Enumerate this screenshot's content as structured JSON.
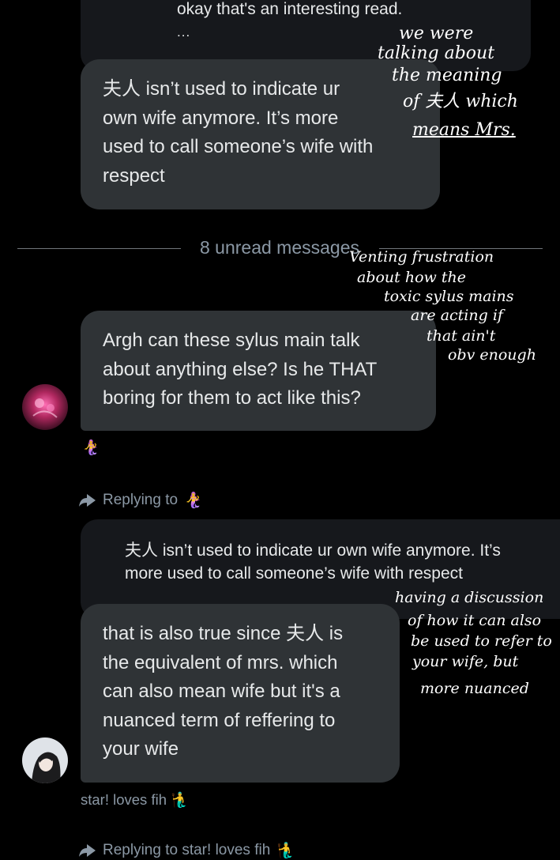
{
  "top_quote": {
    "text": "okay that's an interesting read.",
    "ellipsis": "..."
  },
  "messages": [
    {
      "text_lines": [
        "夫人 isn’t used to indicate ur",
        "own wife anymore. It’s more",
        "used to call someone’s wife with",
        "respect"
      ]
    },
    {
      "text_lines": [
        "Argh can these sylus main talk",
        "about anything else? Is he THAT",
        "boring for them to act like this?"
      ],
      "reaction": "🧜‍♀️"
    },
    {
      "replying_to_label": "Replying to",
      "replying_to_emoji": "🧜‍♀️",
      "quoted_lines": [
        "夫人 isn’t used to indicate ur own wife anymore. It’s",
        "more used to call someone’s wife with respect"
      ],
      "text_lines": [
        "that is also true since 夫人 is",
        "the equivalent of mrs. which",
        "can also mean wife but it's a",
        "nuanced term of reffering to",
        "your wife"
      ],
      "sender": "star! loves fih 🧜‍♂️"
    }
  ],
  "unread_divider": "8 unread messages",
  "next_reply": {
    "label": "Replying to star! loves fih",
    "emoji": "🧜‍♂️"
  },
  "annotations": {
    "note1": [
      "we were",
      "talking about",
      "the meaning",
      "of 夫人 which",
      "means Mrs."
    ],
    "note2": [
      "Venting frustration",
      "about how the",
      "toxic sylus mains",
      "are acting if",
      "that ain't",
      "obv enough"
    ],
    "note3": [
      "having a discussion",
      "of how it can also",
      "be used to refer to",
      "your wife, but",
      "more nuanced"
    ]
  },
  "colors": {
    "background": "#000000",
    "bubble": "#2f3336",
    "quote": "#16181c",
    "muted_text": "#8b98a5"
  }
}
